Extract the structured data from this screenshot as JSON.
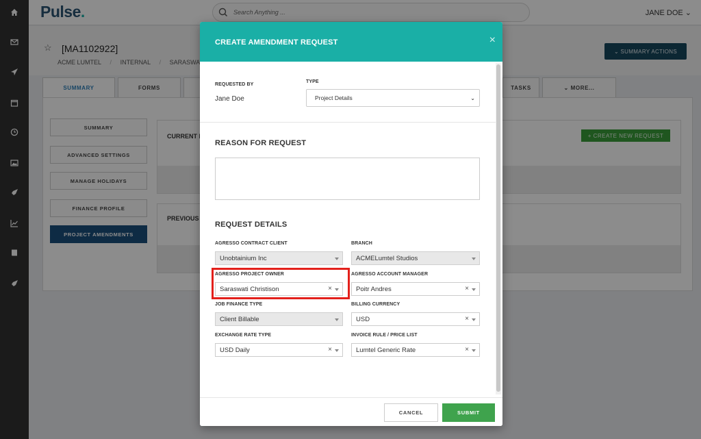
{
  "app": {
    "logo": "Pulse",
    "logo_dot": "."
  },
  "search": {
    "placeholder": "Search Anything ..."
  },
  "user": {
    "name": "JANE DOE ⌄"
  },
  "sidebar": {
    "icons": [
      "home-icon",
      "mail-icon",
      "send-icon",
      "calendar-icon",
      "clock-icon",
      "image-icon",
      "rocket-icon",
      "chart-icon",
      "book-icon",
      "rocket-icon"
    ]
  },
  "record": {
    "star": "☆",
    "id": "[MA1102922]",
    "crumbs": [
      "ACME LUMTEL",
      "INTERNAL",
      "SARASWATI CH"
    ],
    "crumb_sep": "/",
    "summary_actions": "⌄  SUMMARY ACTIONS"
  },
  "tabs": {
    "summary": "SUMMARY",
    "forms": "FORMS",
    "tasks": "TASKS",
    "more": "⌄  MORE..."
  },
  "side_nav": [
    "SUMMARY",
    "ADVANCED SETTINGS",
    "MANAGE HOLIDAYS",
    "FINANCE PROFILE",
    "PROJECT AMENDMENTS"
  ],
  "panels": {
    "current": "CURRENT F",
    "previous": "PREVIOUS",
    "create_button": "+ CREATE NEW REQUEST"
  },
  "modal": {
    "title": "CREATE AMENDMENT REQUEST",
    "close": "×",
    "requested_by_label": "REQUESTED BY",
    "requested_by_value": "Jane Doe",
    "type_label": "TYPE",
    "type_value": "Project Details",
    "type_chevron": "⌄",
    "reason_title": "REASON FOR REQUEST",
    "reason_value": "",
    "details_title": "REQUEST DETAILS",
    "fields": {
      "contract_client": {
        "label": "AGRESSO CONTRACT CLIENT",
        "value": "Unobtainium Inc"
      },
      "branch": {
        "label": "BRANCH",
        "value": "ACMELumtel Studios"
      },
      "project_owner": {
        "label": "AGRESSO PROJECT OWNER",
        "value": "Saraswati Christison"
      },
      "account_manager": {
        "label": "AGRESSO ACCOUNT MANAGER",
        "value": "Poitr Andres"
      },
      "job_finance_type": {
        "label": "JOB FINANCE TYPE",
        "value": "Client Billable"
      },
      "billing_currency": {
        "label": "BILLING CURRENCY",
        "value": "USD"
      },
      "exchange_rate_type": {
        "label": "EXCHANGE RATE TYPE",
        "value": "USD Daily"
      },
      "invoice_rule": {
        "label": "INVOICE RULE / PRICE LIST",
        "value": "Lumtel Generic Rate"
      }
    },
    "clear_glyph": "×",
    "cancel": "CANCEL",
    "submit": "SUBMIT"
  },
  "colors": {
    "modal_header": "#1aafa6",
    "submit": "#3fa34d",
    "highlight": "#e3201b",
    "active_nav": "#1b4f7c"
  }
}
